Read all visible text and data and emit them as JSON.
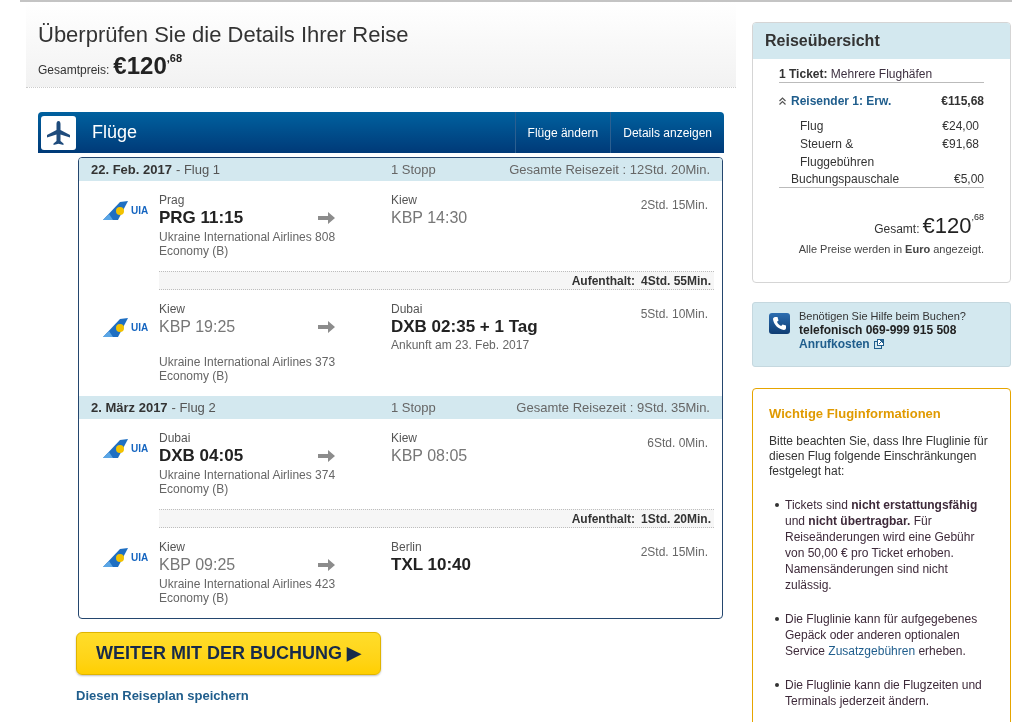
{
  "header": {
    "title": "Überprüfen Sie die Details Ihrer Reise",
    "total_label": "Gesamtpreis:",
    "total_main": "€120",
    "total_cents": ",68"
  },
  "flights_panel": {
    "title": "Flüge",
    "actions": [
      "Flüge ändern",
      "Details anzeigen"
    ]
  },
  "legs": [
    {
      "date": "22. Feb. 2017",
      "label": "- Flug 1",
      "stops": "1 Stopp",
      "travel_time": "Gesamte Reisezeit : 12Std. 20Min.",
      "segments": [
        {
          "logo": "UIA",
          "departure": {
            "city": "Prag",
            "code_time": "PRG 11:15",
            "highlighted": true
          },
          "arrival": {
            "city": "Kiew",
            "code_time": "KBP 14:30",
            "highlighted": false
          },
          "airline": "Ukraine International Airlines 808",
          "cabin": "Economy (B)",
          "duration": "2Std. 15Min."
        },
        {
          "logo": "UIA",
          "departure": {
            "city": "Kiew",
            "code_time": "KBP 19:25",
            "highlighted": false
          },
          "arrival": {
            "city": "Dubai",
            "code_time": "DXB 02:35 + 1 Tag",
            "highlighted": true,
            "note": "Ankunft am 23. Feb. 2017"
          },
          "airline": "Ukraine International Airlines 373",
          "cabin": "Economy (B)",
          "duration": "5Std. 10Min."
        }
      ],
      "layovers": [
        {
          "label": "Aufenthalt:",
          "duration": "4Std. 55Min."
        }
      ]
    },
    {
      "date": "2. März 2017",
      "label": "- Flug 2",
      "stops": "1 Stopp",
      "travel_time": "Gesamte Reisezeit : 9Std. 35Min.",
      "segments": [
        {
          "logo": "UIA",
          "departure": {
            "city": "Dubai",
            "code_time": "DXB 04:05",
            "highlighted": true
          },
          "arrival": {
            "city": "Kiew",
            "code_time": "KBP 08:05",
            "highlighted": false
          },
          "airline": "Ukraine International Airlines 374",
          "cabin": "Economy (B)",
          "duration": "6Std. 0Min."
        },
        {
          "logo": "UIA",
          "departure": {
            "city": "Kiew",
            "code_time": "KBP 09:25",
            "highlighted": false
          },
          "arrival": {
            "city": "Berlin",
            "code_time": "TXL 10:40",
            "highlighted": true
          },
          "airline": "Ukraine International Airlines 423",
          "cabin": "Economy (B)",
          "duration": "2Std. 15Min."
        }
      ],
      "layovers": [
        {
          "label": "Aufenthalt:",
          "duration": "1Std. 20Min."
        }
      ]
    }
  ],
  "continue_button": "WEITER MIT DER BUCHUNG ▶",
  "save_link": "Diesen Reiseplan speichern",
  "summary": {
    "title": "Reiseübersicht",
    "ticket_label": "1 Ticket:",
    "ticket_value": "Mehrere Flughäfen",
    "traveler": {
      "label": "Reisender 1: Erw.",
      "amount": "€115,68",
      "expanded": true,
      "items": [
        {
          "label": "Flug",
          "amount": "€24,00"
        },
        {
          "label": "Steuern & Fluggebühren",
          "amount": "€91,68"
        }
      ]
    },
    "fee": {
      "label": "Buchungspauschale",
      "amount": "€5,00"
    },
    "total_label": "Gesamt:",
    "total_main": "€120",
    "total_cents": ",68",
    "note": "Alle Preise werden in **Euro** angezeigt."
  },
  "help": {
    "question": "Benötigen Sie Hilfe beim Buchen?",
    "phone": "telefonisch 069-999 915 508",
    "link": "Anrufkosten"
  },
  "info": {
    "title": "Wichtige Fluginformationen",
    "intro": "Bitte beachten Sie, dass Ihre Fluglinie für diesen Flug folgende Einschränkungen festgelegt hat:",
    "bullets": [
      {
        "parts": [
          {
            "kind": "text",
            "text": "Tickets sind **nicht erstattungsfähig** und **nicht übertragbar.** Für Reiseänderungen wird eine Gebühr von 50,00 € pro Ticket erhoben. Namensänderungen sind nicht zulässig."
          }
        ]
      },
      {
        "parts": [
          {
            "kind": "text",
            "text": "Die Fluglinie kann für aufgegebenes Gepäck oder anderen optionalen Service "
          },
          {
            "kind": "link",
            "text": "Zusatzgebühren"
          },
          {
            "kind": "text",
            "text": " erheben."
          }
        ]
      },
      {
        "parts": [
          {
            "kind": "text",
            "text": "Die Fluglinie kann die Flugzeiten und Terminals jederzeit ändern."
          }
        ]
      }
    ]
  }
}
